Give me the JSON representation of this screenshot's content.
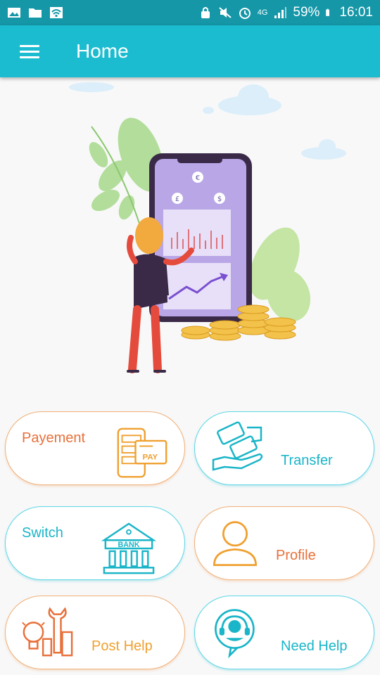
{
  "status_bar": {
    "battery": "59%",
    "time": "16:01",
    "network": "4G"
  },
  "app_bar": {
    "title": "Home"
  },
  "cards": {
    "payement": {
      "label": "Payement",
      "icon_text": "PAY"
    },
    "transfer": {
      "label": "Transfer"
    },
    "switch": {
      "label": "Switch",
      "icon_text": "BANK"
    },
    "profile": {
      "label": "Profile"
    },
    "post_help": {
      "label": "Post Help"
    },
    "need_help": {
      "label": "Need Help"
    }
  },
  "colors": {
    "primary": "#1cbcd0",
    "status_bar": "#1597a8",
    "orange": "#e8703a",
    "amber": "#f0a030",
    "cyan": "#1ab5c8"
  }
}
